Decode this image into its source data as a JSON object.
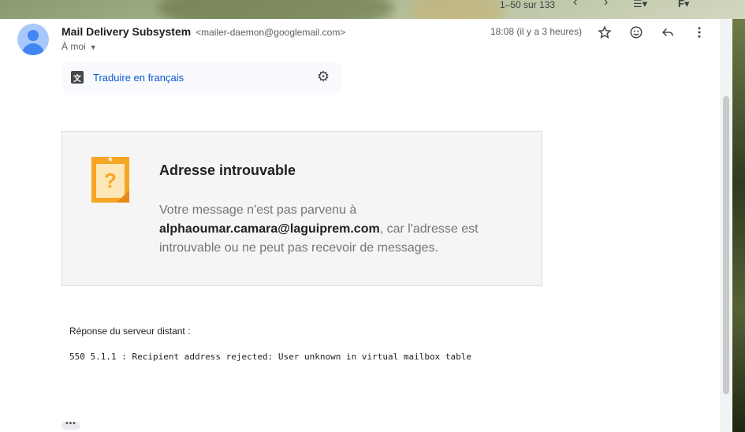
{
  "toolbar": {
    "pager": "1–50 sur 133",
    "input_tools": "F"
  },
  "message": {
    "sender_name": "Mail Delivery Subsystem",
    "sender_email": "<mailer-daemon@googlemail.com>",
    "recipient": "À moi",
    "timestamp": "18:08 (il y a 3 heures)"
  },
  "translate": {
    "link": "Traduire en français"
  },
  "bounce": {
    "title": "Adresse introuvable",
    "text_before": "Votre message n'est pas parvenu à ",
    "address": "alphaoumar.camara@laguiprem.com",
    "text_after": ", car l'adresse est introuvable ou ne peut pas recevoir de messages."
  },
  "server": {
    "label": "Réponse du serveur distant :",
    "response": "550 5.1.1 : Recipient address rejected: User unknown in virtual mailbox table"
  },
  "colors": {
    "link": "#0b57d0",
    "note_icon": "#f6a623",
    "avatar": "#4285f4"
  }
}
